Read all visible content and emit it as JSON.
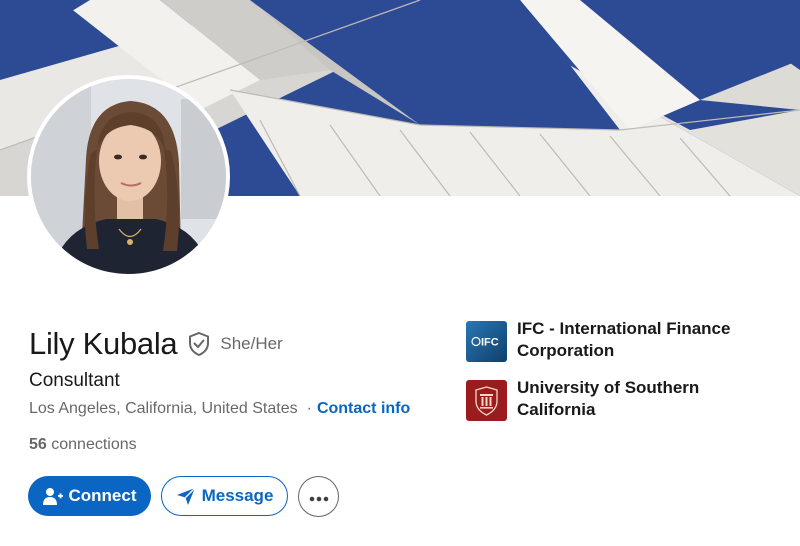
{
  "profile": {
    "name": "Lily Kubala",
    "pronouns": "She/Her",
    "headline": "Consultant",
    "location": "Los Angeles, California, United States",
    "separator": "·",
    "contact_label": "Contact info",
    "connections_count": "56",
    "connections_label": "connections"
  },
  "actions": {
    "connect_label": "Connect",
    "message_label": "Message"
  },
  "organizations": [
    {
      "name": "IFC - International Finance Corporation",
      "logo": "IFC"
    },
    {
      "name": "University of Southern California",
      "logo": "usc-seal"
    }
  ],
  "colors": {
    "brand": "#0a66c2",
    "banner_sky": "#2c4b9a",
    "ifc_logo": "#1a5b8c",
    "usc_logo": "#9b1c1f"
  },
  "icons": {
    "verify": "shield-check-icon",
    "connect": "person-add-icon",
    "message": "send-icon",
    "more": "more-horizontal-icon"
  }
}
